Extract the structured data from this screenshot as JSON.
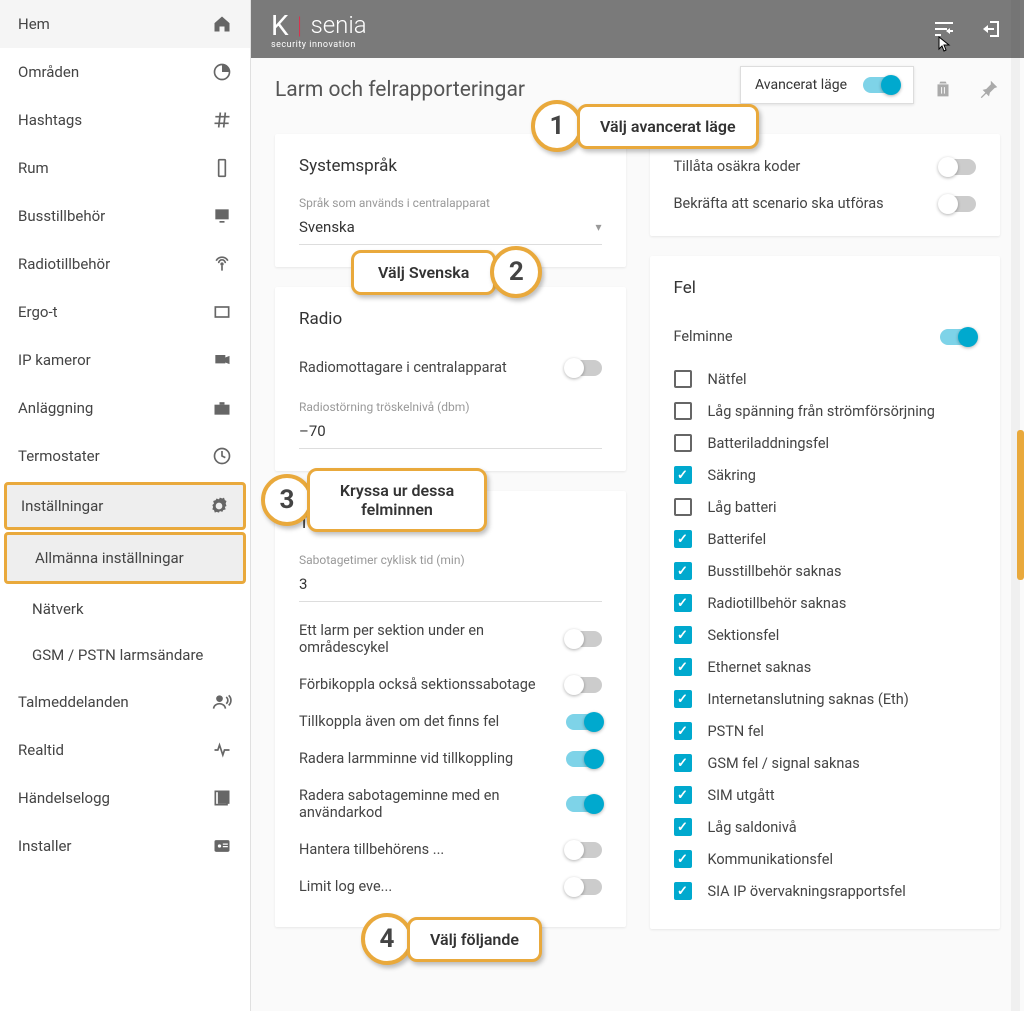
{
  "sidebar": {
    "items": [
      {
        "label": "Hem",
        "icon": "home"
      },
      {
        "label": "Områden",
        "icon": "pie"
      },
      {
        "label": "Hashtags",
        "icon": "hash"
      },
      {
        "label": "Rum",
        "icon": "phone"
      },
      {
        "label": "Busstillbehör",
        "icon": "monitor"
      },
      {
        "label": "Radiotillbehör",
        "icon": "radio"
      },
      {
        "label": "Ergo-t",
        "icon": "rect"
      },
      {
        "label": "IP kameror",
        "icon": "camera"
      },
      {
        "label": "Anläggning",
        "icon": "briefcase"
      },
      {
        "label": "Termostater",
        "icon": "thermo"
      },
      {
        "label": "Inställningar",
        "icon": "gear",
        "selected": true
      },
      {
        "label": "Allmänna inställningar",
        "sub": true,
        "selected": true
      },
      {
        "label": "Nätverk",
        "sub": true
      },
      {
        "label": "GSM / PSTN larmsändare",
        "sub": true
      },
      {
        "label": "Talmeddelanden",
        "icon": "speak"
      },
      {
        "label": "Realtid",
        "icon": "pulse"
      },
      {
        "label": "Händelselogg",
        "icon": "log"
      },
      {
        "label": "Installer",
        "icon": "badge"
      }
    ]
  },
  "logo": {
    "brand": "Ksenia",
    "sub": "security innovation"
  },
  "page_title": "Larm och felrapporteringar",
  "adv_mode": {
    "label": "Avancerat läge",
    "on": true
  },
  "cards": {
    "lang": {
      "title": "Systemspråk",
      "field_label": "Språk som används i centralapparat",
      "value": "Svenska"
    },
    "security": {
      "rows": [
        {
          "label": "Tillåta osäkra koder",
          "on": false
        },
        {
          "label": "Bekräfta att scenario ska utföras",
          "on": false
        }
      ]
    },
    "radio": {
      "title": "Radio",
      "receiver": {
        "label": "Radiomottagare i centralapparat",
        "on": false
      },
      "noise_label": "Radiostörning tröskelnivå (dbm)",
      "noise_value": "–70"
    },
    "arming": {
      "title": "Tillkoppling",
      "sab_label": "Sabotagetimer cyklisk tid (min)",
      "sab_value": "3",
      "rows": [
        {
          "label": "Ett larm per sektion under en områdescykel",
          "on": false
        },
        {
          "label": "Förbikoppla också sektionssabotage",
          "on": false
        },
        {
          "label": "Tillkoppla även om det finns fel",
          "on": true
        },
        {
          "label": "Radera larmminne vid tillkoppling",
          "on": true
        },
        {
          "label": "Radera sabotageminne med en användarkod",
          "on": true
        },
        {
          "label": "Hantera tillbehörens ...",
          "on": false
        },
        {
          "label": "Limit log eve...",
          "on": false
        }
      ]
    },
    "fel": {
      "title": "Fel",
      "felminne": {
        "label": "Felminne",
        "on": true
      },
      "items": [
        {
          "label": "Nätfel",
          "checked": false
        },
        {
          "label": "Låg spänning från strömförsörjning",
          "checked": false
        },
        {
          "label": "Batteriladdningsfel",
          "checked": false
        },
        {
          "label": "Säkring",
          "checked": true
        },
        {
          "label": "Låg batteri",
          "checked": false
        },
        {
          "label": "Batterifel",
          "checked": true
        },
        {
          "label": "Busstillbehör saknas",
          "checked": true
        },
        {
          "label": "Radiotillbehör saknas",
          "checked": true
        },
        {
          "label": "Sektionsfel",
          "checked": true
        },
        {
          "label": "Ethernet saknas",
          "checked": true
        },
        {
          "label": "Internetanslutning saknas (Eth)",
          "checked": true
        },
        {
          "label": "PSTN fel",
          "checked": true
        },
        {
          "label": "GSM fel / signal saknas",
          "checked": true
        },
        {
          "label": "SIM utgått",
          "checked": true
        },
        {
          "label": "Låg saldonivå",
          "checked": true
        },
        {
          "label": "Kommunikationsfel",
          "checked": true
        },
        {
          "label": "SIA IP övervakningsrapportsfel",
          "checked": true
        }
      ]
    }
  },
  "callouts": {
    "c1": {
      "num": "1",
      "text": "Välj avancerat läge"
    },
    "c2": {
      "num": "2",
      "text": "Välj Svenska"
    },
    "c3": {
      "num": "3",
      "text": "Kryssa ur dessa felminnen"
    },
    "c4": {
      "num": "4",
      "text": "Välj följande"
    }
  }
}
